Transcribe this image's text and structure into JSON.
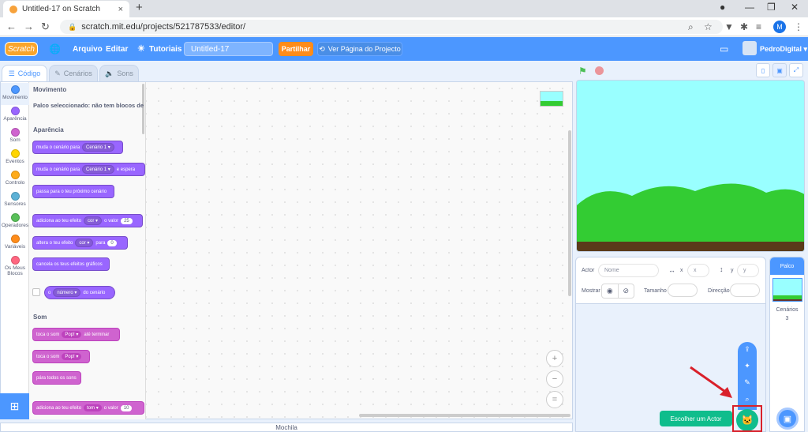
{
  "browser": {
    "tab_title": "Untitled-17 on Scratch",
    "tab_close": "×",
    "new_tab": "+",
    "url": "scratch.mit.edu/projects/521787533/editor/",
    "profile_initial": "M"
  },
  "menubar": {
    "logo": "Scratch",
    "language": "",
    "file": "Arquivo",
    "edit": "Editar",
    "tutorials": "Tutoriais",
    "project_title": "Untitled-17",
    "share": "Partilhar",
    "see_project": "Ver Página do Projecto",
    "username": "PedroDigital"
  },
  "editor_tabs": {
    "code": "Código",
    "costumes": "Cenários",
    "sounds": "Sons"
  },
  "categories": [
    {
      "label": "Movimento",
      "color": "#4c97ff"
    },
    {
      "label": "Aparência",
      "color": "#9966ff"
    },
    {
      "label": "Som",
      "color": "#cf63cf"
    },
    {
      "label": "Eventos",
      "color": "#ffd500"
    },
    {
      "label": "Controlo",
      "color": "#ffab19"
    },
    {
      "label": "Sensores",
      "color": "#5cb1d6"
    },
    {
      "label": "Operadores",
      "color": "#59c059"
    },
    {
      "label": "Variáveis",
      "color": "#ff8c1a"
    },
    {
      "label": "Os Meus Blocos",
      "color": "#ff6680"
    }
  ],
  "palette": {
    "motion_head": "Movimento",
    "motion_note": "Palco seleccionado: não tem blocos de",
    "looks_head": "Aparência",
    "b1_text": "muda o cenário para",
    "b1_pill": "Cenário 1",
    "b2_text": "muda o cenário para",
    "b2_pill": "Cenário 1",
    "b2_tail": "e espera",
    "b3_text": "passa para o teu próximo cenário",
    "b4_text": "adiciona ao teu efeito",
    "b4_pill": "cor",
    "b4_mid": "o valor",
    "b4_val": "25",
    "b5_text": "altera o teu efeito",
    "b5_pill": "cor",
    "b5_mid": "para",
    "b5_val": "0",
    "b6_text": "cancela os teus efeitos gráficos",
    "b7_pill0": "o",
    "b7_pill": "número",
    "b7_tail": "do cenário",
    "sound_head": "Som",
    "s1_text": "toca o som",
    "s1_pill": "Pop!",
    "s1_tail": "até terminar",
    "s2_text": "toca o som",
    "s2_pill": "Pop!",
    "s3_text": "pára todos os sons",
    "s4_text": "adiciona ao teu efeito",
    "s4_pill": "tom",
    "s4_mid": "o valor",
    "s4_val": "10"
  },
  "zoom": {
    "in": "+",
    "out": "−",
    "reset": "="
  },
  "backpack": "Mochila",
  "sprite_info": {
    "sprite_label": "Actor",
    "name_placeholder": "Nome",
    "x_label": "x",
    "x_placeholder": "x",
    "y_label": "y",
    "y_placeholder": "y",
    "show_label": "Mostrar",
    "size_label": "Tamanho",
    "direction_label": "Direcção"
  },
  "stage_panel": {
    "header": "Palco",
    "backdrops_label": "Cenários",
    "backdrops_count": "3"
  },
  "add_sprite": {
    "tooltip": "Escolher um Actor"
  },
  "colors": {
    "accent": "#4c97ff",
    "share": "#ff8c1a",
    "add_sprite_green": "#0fbd8c",
    "highlight": "#d9202a",
    "stage_sky": "#99ffff",
    "stage_grass": "#33cc33"
  }
}
